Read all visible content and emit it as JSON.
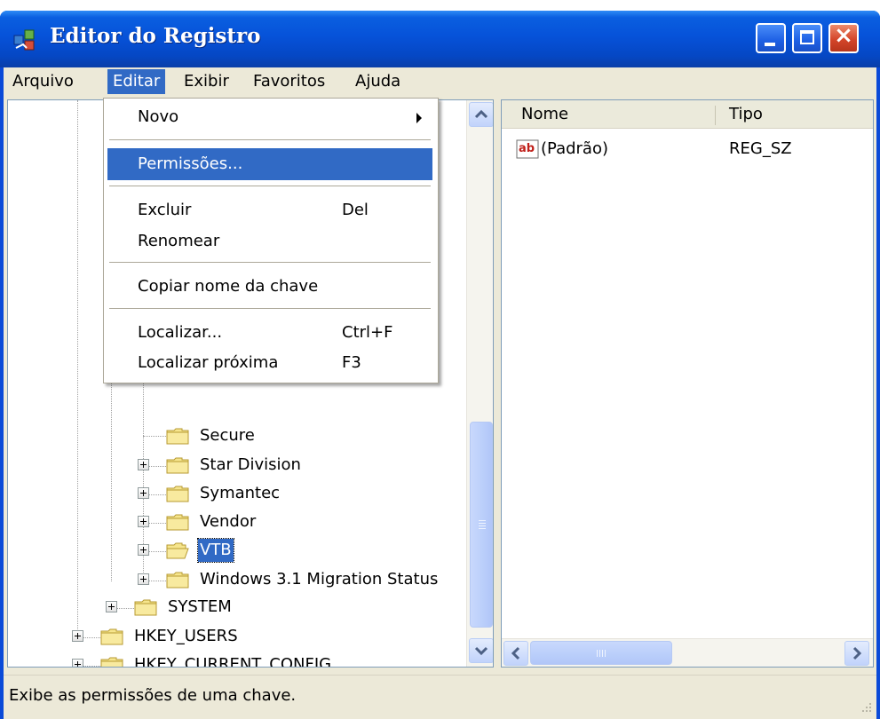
{
  "window": {
    "title": "Editor do Registro"
  },
  "menubar": {
    "items": [
      "Arquivo",
      "Editar",
      "Exibir",
      "Favoritos",
      "Ajuda"
    ],
    "active": "Editar"
  },
  "edit_menu": {
    "items": [
      {
        "label": "Novo",
        "shortcut": "",
        "submenu": true
      },
      {
        "label": "Permissões...",
        "shortcut": "",
        "highlighted": true
      },
      {
        "label": "Excluir",
        "shortcut": "Del"
      },
      {
        "label": "Renomear",
        "shortcut": ""
      },
      {
        "label": "Copiar nome da chave",
        "shortcut": ""
      },
      {
        "label": "Localizar...",
        "shortcut": "Ctrl+F"
      },
      {
        "label": "Localizar próxima",
        "shortcut": "F3"
      }
    ]
  },
  "tree": {
    "nodes": [
      {
        "label": "Secure",
        "expandable": false
      },
      {
        "label": "Star Division",
        "expandable": true
      },
      {
        "label": "Symantec",
        "expandable": true
      },
      {
        "label": "Vendor",
        "expandable": true
      },
      {
        "label": "VTB",
        "expandable": true,
        "selected": true
      },
      {
        "label": "Windows 3.1 Migration Status",
        "expandable": true
      },
      {
        "label": "SYSTEM",
        "expandable": true
      },
      {
        "label": "HKEY_USERS",
        "expandable": true
      },
      {
        "label": "HKEY_CURRENT_CONFIG",
        "expandable": true
      }
    ]
  },
  "list": {
    "columns": [
      "Nome",
      "Tipo"
    ],
    "rows": [
      {
        "name": "(Padrão)",
        "type": "REG_SZ"
      }
    ]
  },
  "status": {
    "text": "Exibe as permissões de uma chave."
  },
  "colors": {
    "title_bar": "#0a5fe0",
    "selection": "#316ac5",
    "close_button": "#d4462a",
    "folder": "#f6e58d"
  }
}
